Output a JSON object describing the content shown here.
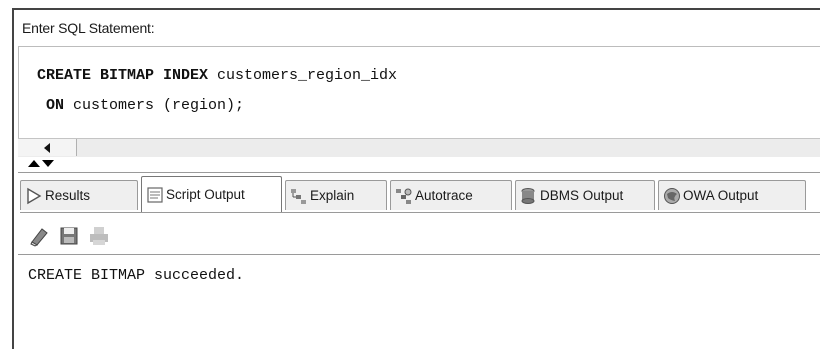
{
  "statement_panel": {
    "label": "Enter SQL Statement:",
    "lines": [
      {
        "keywords": "CREATE BITMAP INDEX",
        "rest": " customers_region_idx"
      },
      {
        "keywords": " ON",
        "rest": " customers (region);"
      }
    ]
  },
  "tabs": [
    {
      "label": "Results",
      "icon": "results-play-icon"
    },
    {
      "label": "Script Output",
      "icon": "script-output-icon",
      "active": true
    },
    {
      "label": "Explain",
      "icon": "explain-plan-icon"
    },
    {
      "label": "Autotrace",
      "icon": "autotrace-icon"
    },
    {
      "label": "DBMS Output",
      "icon": "dbms-output-icon"
    },
    {
      "label": "OWA Output",
      "icon": "owa-output-icon"
    }
  ],
  "toolbar": {
    "icons": [
      "eraser-icon",
      "save-icon",
      "print-icon"
    ]
  },
  "output": {
    "text": "CREATE BITMAP succeeded."
  }
}
